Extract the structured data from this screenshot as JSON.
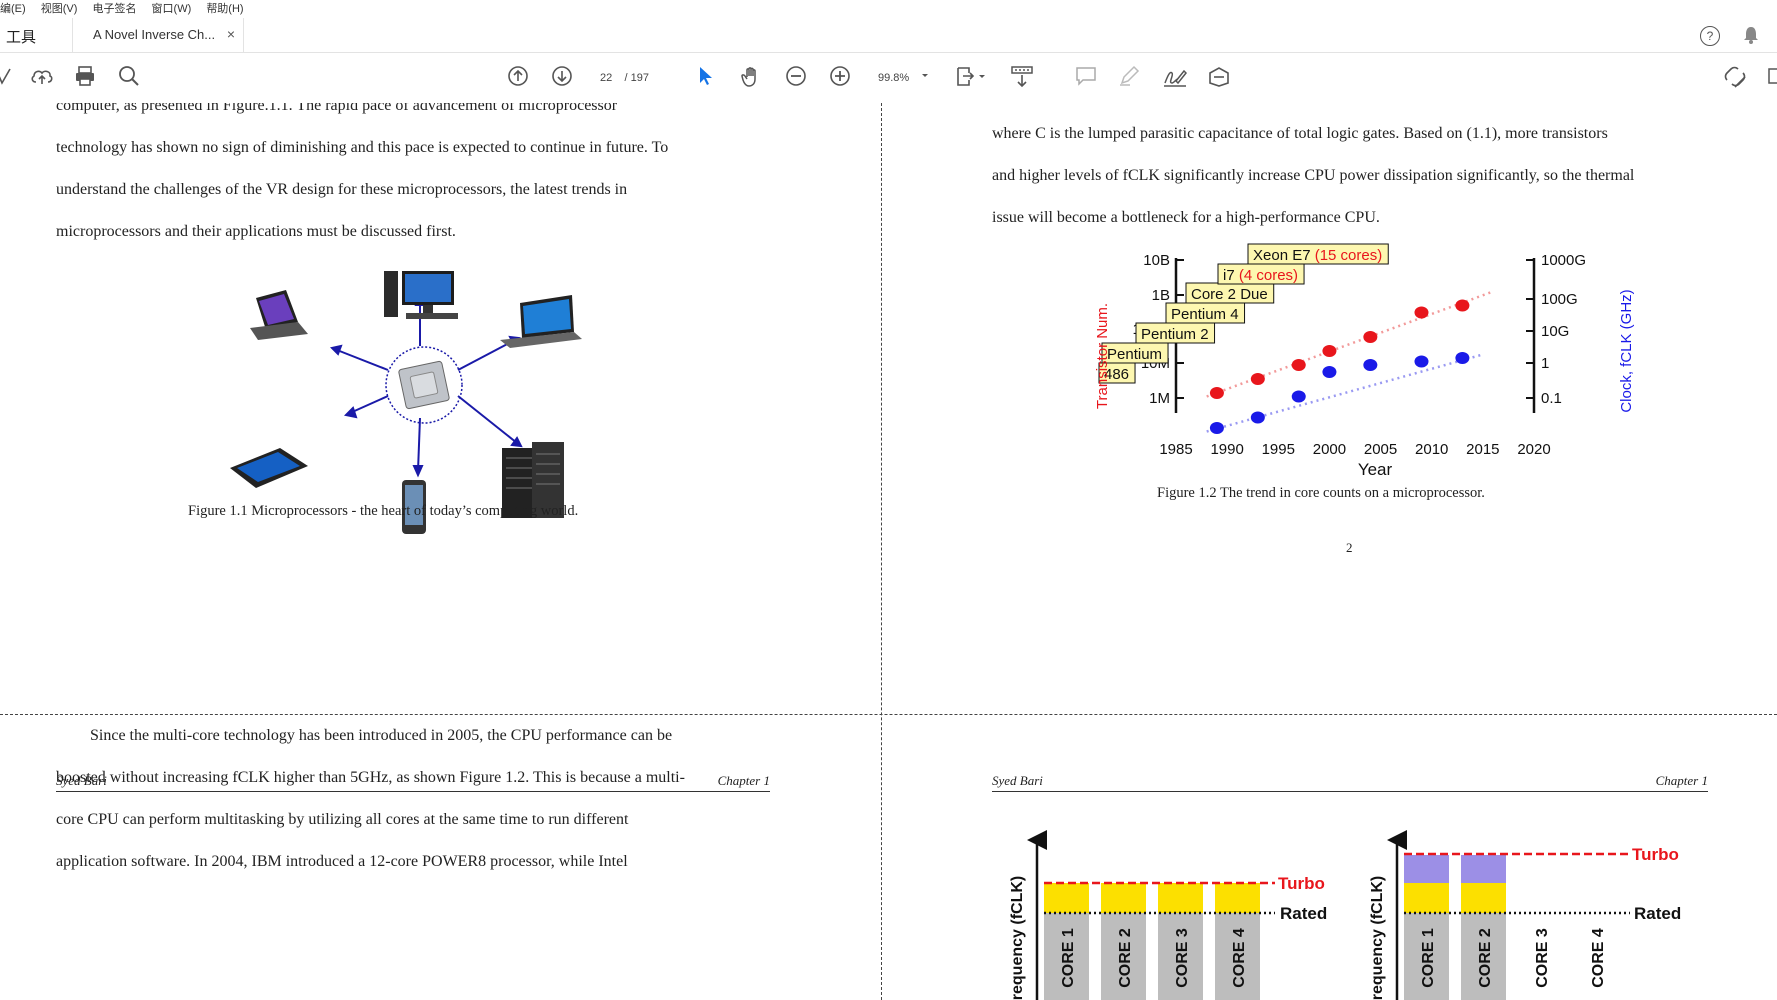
{
  "menu": [
    "编(E)",
    "视图(V)",
    "电子签名",
    "窗口(W)",
    "帮助(H)"
  ],
  "tabs": {
    "tools": "工具",
    "document": "A Novel Inverse Ch...",
    "close": "×"
  },
  "toolbar": {
    "page_current": "22",
    "page_total": "/ 197",
    "zoom": "99.8%"
  },
  "page_top_left": {
    "cut_line": "computer, as presented in Figure.1.1. The rapid pace of advancement of microprocessor",
    "lines": [
      "technology has shown no sign of diminishing and this pace is expected to continue in future. To",
      "understand the challenges of the VR design for these microprocessors, the latest trends in",
      "microprocessors and their applications must be discussed first."
    ],
    "figure_caption": "Figure 1.1 Microprocessors - the heart of today’s computing world."
  },
  "page_top_right": {
    "lines": [
      "where C is the lumped parasitic capacitance of total logic gates. Based on (1.1), more transistors",
      "and higher levels of fCLK significantly increase CPU power dissipation significantly, so the thermal",
      "issue will become a bottleneck for a high-performance CPU."
    ],
    "figure_caption": "Figure 1.2  The trend in core counts on a microprocessor.",
    "page_number": "2"
  },
  "chart_data": {
    "type": "scatter",
    "xlabel": "Year",
    "ylabel_left": "Transistor Num.",
    "ylabel_right": "Clock, fCLK (GHz)",
    "xlim": [
      1985,
      2020
    ],
    "x_ticks": [
      "1985",
      "1990",
      "1995",
      "2000",
      "2005",
      "2010",
      "2015",
      "2020"
    ],
    "left_ticks": [
      "10B",
      "1B",
      "100M",
      "10M",
      "1M"
    ],
    "right_ticks": [
      "1000G",
      "100G",
      "10G",
      "1",
      "0.1"
    ],
    "series": [
      {
        "color": "#e8161c",
        "x": [
          1989,
          1993,
          1997,
          2000,
          2004,
          2009,
          2013
        ],
        "y_log": [
          6.2,
          6.6,
          7.0,
          7.4,
          7.8,
          8.5,
          8.7
        ]
      },
      {
        "color": "#1a1ae8",
        "x": [
          1989,
          1993,
          1997,
          2000,
          2004,
          2009,
          2013
        ],
        "y_log": [
          5.2,
          5.5,
          6.1,
          6.8,
          7.0,
          7.1,
          7.2
        ]
      }
    ],
    "labels": [
      {
        "name": "486",
        "extra": ""
      },
      {
        "name": "Pentium",
        "extra": ""
      },
      {
        "name": "Pentium  2",
        "extra": ""
      },
      {
        "name": "Pentium  4",
        "extra": ""
      },
      {
        "name": "Core 2 Due",
        "extra": ""
      },
      {
        "name": "i7",
        "extra": "(4 cores)"
      },
      {
        "name": "Xeon E7",
        "extra": "(15 cores)"
      }
    ]
  },
  "page_bottom_left": {
    "header_left": "Syed Bari",
    "header_right": "Chapter 1",
    "lines": [
      "Since the multi-core technology has been introduced in 2005, the CPU performance can be",
      "boosted without increasing fCLK higher than 5GHz, as shown Figure 1.2. This is because a multi-",
      "core CPU can perform multitasking by utilizing all cores at the same time to run different",
      "application software. In 2004, IBM introduced a 12-core POWER8 processor, while Intel"
    ]
  },
  "page_bottom_right": {
    "header_left": "Syed Bari",
    "header_right": "Chapter 1",
    "y_label": "requency (fCLK)",
    "turbo_label": "Turbo",
    "rated_label": "Rated",
    "cores": [
      "CORE 1",
      "CORE 2",
      "CORE 3",
      "CORE 4"
    ]
  }
}
